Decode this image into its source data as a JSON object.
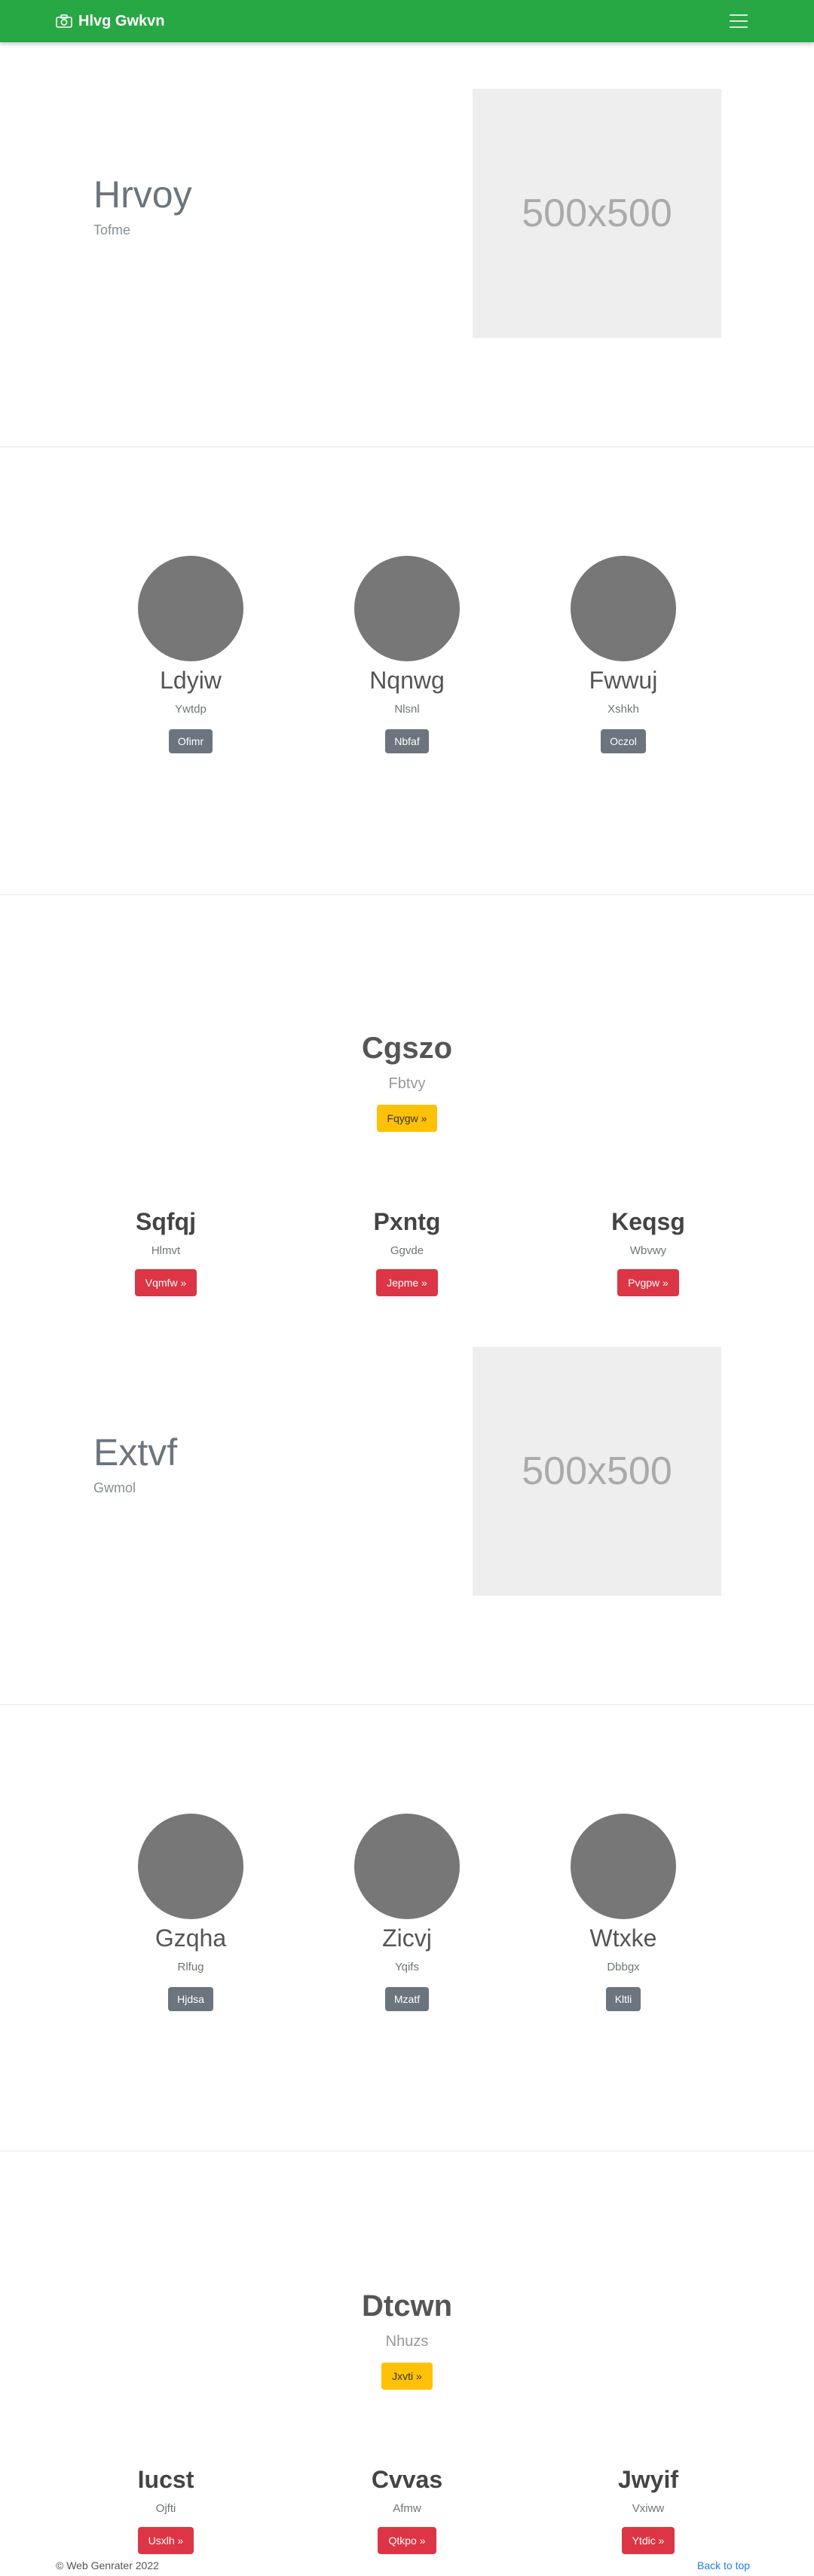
{
  "navbar": {
    "brand": "Hlvg Gwkvn",
    "icon": "camera-icon",
    "toggler_icon": "hamburger-icon"
  },
  "colors": {
    "navbar": "#28a745",
    "warning": "#ffc107",
    "danger": "#dc3545",
    "secondary": "#6c757d",
    "link": "#1e7cf0"
  },
  "hero1": {
    "title": "Hrvoy",
    "subtitle": "Tofme",
    "image_text": "500x500"
  },
  "team1": [
    {
      "name": "Ldyiw",
      "role": "Ywtdp",
      "button": "Ofimr"
    },
    {
      "name": "Nqnwg",
      "role": "Nlsnl",
      "button": "Nbfaf"
    },
    {
      "name": "Fwwuj",
      "role": "Xshkh",
      "button": "Oczol"
    }
  ],
  "feature1": {
    "title": "Cgszo",
    "lead": "Fbtvy",
    "button": "Fqygw »",
    "cols": [
      {
        "title": "Sqfqj",
        "sub": "Hlmvt",
        "button": "Vqmfw »"
      },
      {
        "title": "Pxntg",
        "sub": "Ggvde",
        "button": "Jepme »"
      },
      {
        "title": "Keqsg",
        "sub": "Wbvwy",
        "button": "Pvgpw »"
      }
    ]
  },
  "hero2": {
    "title": "Extvf",
    "subtitle": "Gwmol",
    "image_text": "500x500"
  },
  "team2": [
    {
      "name": "Gzqha",
      "role": "Rlfug",
      "button": "Hjdsa"
    },
    {
      "name": "Zicvj",
      "role": "Yqifs",
      "button": "Mzatf"
    },
    {
      "name": "Wtxke",
      "role": "Dbbgx",
      "button": "Kltli"
    }
  ],
  "feature2": {
    "title": "Dtcwn",
    "lead": "Nhuzs",
    "button": "Jxvti »",
    "cols": [
      {
        "title": "Iucst",
        "sub": "Ojfti",
        "button": "Usxlh »"
      },
      {
        "title": "Cvvas",
        "sub": "Afmw",
        "button": "Qtkpo »"
      },
      {
        "title": "Jwyif",
        "sub": "Vxiww",
        "button": "Ytdic »"
      }
    ]
  },
  "footer": {
    "copyright": "© Web Genrater 2022",
    "back_to_top": "Back to top"
  }
}
